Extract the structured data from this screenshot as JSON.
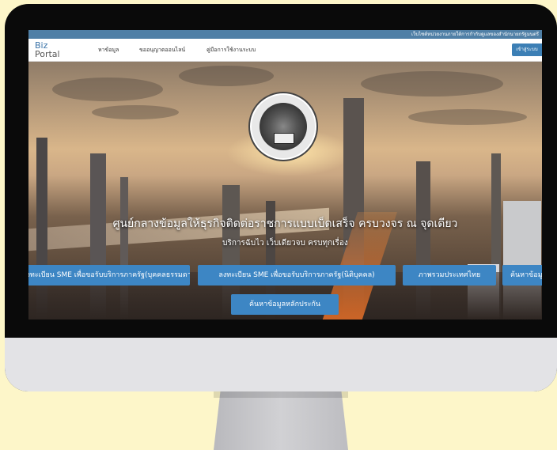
{
  "site": {
    "top_notice": "เว็บไซต์หน่วยงานภายใต้การกำกับดูแลของสำนักนายกรัฐมนตรี",
    "logo_line1": "Biz",
    "logo_line2": "Portal",
    "nav": [
      "หาข้อมูล",
      "ขออนุญาตออนไลน์",
      "คู่มือการใช้งานระบบ"
    ],
    "login_label": "เข้าสู่ระบบ"
  },
  "hero": {
    "headline": "ศูนย์กลางข้อมูลให้ธุรกิจติดต่อราชการแบบเบ็ดเสร็จ ครบวงจร ณ จุดเดียว",
    "subline": "บริการฉับไว เว็บเดียวจบ ครบทุกเรื่อง",
    "buttons": [
      "ลงทะเบียน SME เพื่อขอรับบริการภาครัฐ(บุคคลธรรมดา)",
      "ลงทะเบียน SME เพื่อขอรับบริการภาครัฐ(นิติบุคคล)",
      "ภาพรวมประเทศไทย",
      "ค้นหาข้อมูล"
    ],
    "secondary_button": "ค้นหาข้อมูลหลักประกัน"
  },
  "colors": {
    "page_background": "#fdf6c9",
    "bezel": "#0a0a0a",
    "accent_blue": "#3d86c4",
    "topbar_blue": "#4f7fa6"
  }
}
